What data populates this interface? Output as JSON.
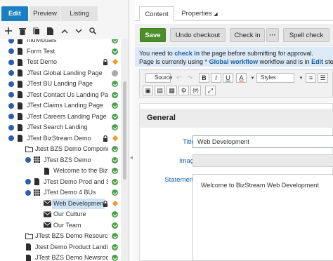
{
  "modeTabs": [
    "Edit",
    "Preview",
    "Listing"
  ],
  "tree": [
    {
      "label": "Individuals",
      "depth": 0,
      "expander": true,
      "icon": "page",
      "status": "ok",
      "partial": true
    },
    {
      "label": "Form Test",
      "depth": 0,
      "expander": true,
      "icon": "page",
      "status": "ok"
    },
    {
      "label": "Test Demo",
      "depth": 0,
      "expander": true,
      "icon": "page",
      "status": "ok",
      "lock": true,
      "diamond": true
    },
    {
      "label": "JTest Global Landing Page",
      "depth": 0,
      "expander": true,
      "icon": "page",
      "status": "gray"
    },
    {
      "label": "JTest BU Landing Page",
      "depth": 0,
      "expander": true,
      "icon": "page",
      "status": "ok"
    },
    {
      "label": "JTest Contact Us Landing Page",
      "depth": 0,
      "expander": true,
      "icon": "page",
      "status": "ok"
    },
    {
      "label": "JTest Claims Landing Page",
      "depth": 0,
      "expander": true,
      "icon": "page",
      "status": "ok"
    },
    {
      "label": "JTest Careers Landing Page",
      "depth": 0,
      "expander": true,
      "icon": "page",
      "status": "ok"
    },
    {
      "label": "JTest Search Landing",
      "depth": 0,
      "expander": true,
      "icon": "page",
      "status": "ok"
    },
    {
      "label": "JTest BizStream Demo",
      "depth": 0,
      "expander": true,
      "icon": "page",
      "status": "ok",
      "lock": true,
      "diamond": true
    },
    {
      "label": "Jtest BZS Demo Componen",
      "depth": 1,
      "expander": false,
      "icon": "folder",
      "status": "ok"
    },
    {
      "label": "JTest BZS Demo",
      "depth": 2,
      "expander": true,
      "icon": "grid",
      "status": "ok"
    },
    {
      "label": "Welcome to the BizStrea",
      "depth": 3,
      "expander": false,
      "icon": "page",
      "status": "ok"
    },
    {
      "label": "JTest Demo Prod and Se",
      "depth": 2,
      "expander": true,
      "icon": "page",
      "status": "ok"
    },
    {
      "label": "JTest Demo 4 BUs",
      "depth": 2,
      "expander": true,
      "icon": "grid",
      "status": "ok"
    },
    {
      "label": "Web Developmen",
      "depth": 3,
      "expander": false,
      "icon": "mail",
      "status": "ok",
      "lock": true,
      "diamond": true,
      "selected": true
    },
    {
      "label": "Our Culture",
      "depth": 3,
      "expander": false,
      "icon": "mail",
      "status": "ok"
    },
    {
      "label": "Our Team",
      "depth": 3,
      "expander": false,
      "icon": "mail",
      "status": "ok"
    },
    {
      "label": "JTest BZS Demo Resources",
      "depth": 1,
      "expander": false,
      "icon": "folder",
      "status": "ok"
    },
    {
      "label": "Jtest Demo Product Landin",
      "depth": 1,
      "expander": false,
      "icon": "page",
      "status": "ok"
    },
    {
      "label": "JTest BZS Demo Newsroom",
      "depth": 1,
      "expander": false,
      "icon": "page",
      "status": "ok",
      "partial": true
    }
  ],
  "contentTabs": [
    "Content",
    "Properties"
  ],
  "actions": {
    "save": "Save",
    "undo": "Undo checkout",
    "checkin": "Check in",
    "more": "···",
    "spell": "Spell check"
  },
  "message": {
    "l1a": "You need to ",
    "l1link": "check in",
    "l1b": " the page before submitting for approval.",
    "l2a": "Page is currently using * ",
    "l2link": "Global workflow",
    "l2b": " workflow and is in ",
    "l2link2": "Edit",
    "l2c": " step."
  },
  "toolbar": {
    "source": "Source",
    "styles": "Styles"
  },
  "section": "General",
  "fields": {
    "title_label": "Title:",
    "title_value": "Web Development",
    "image_label": "Image:",
    "statement_label": "Statement:",
    "statement_value": "Welcome to BizStream Web Development"
  },
  "colors": {
    "accent": "#1b7fc4",
    "save": "#4b8f2b",
    "ok": "#4ca24c",
    "link": "#1b5fa5"
  }
}
